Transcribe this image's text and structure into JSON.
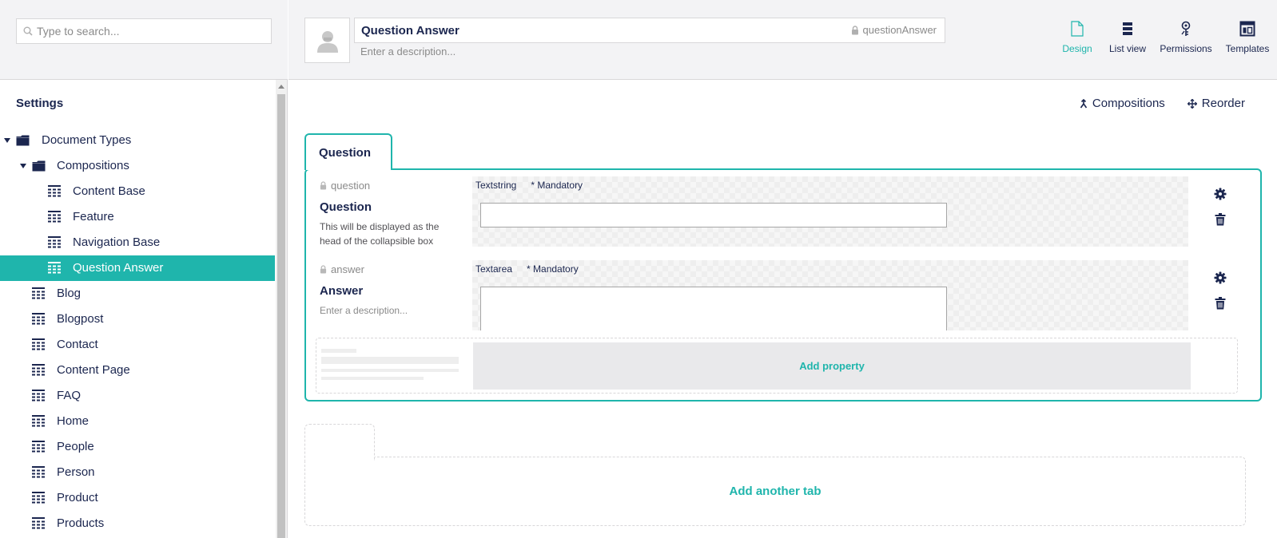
{
  "search": {
    "placeholder": "Type to search..."
  },
  "tree": {
    "title": "Settings",
    "items": [
      {
        "label": "Document Types",
        "level": 0,
        "type": "folder",
        "expanded": true
      },
      {
        "label": "Compositions",
        "level": 1,
        "type": "folder",
        "expanded": true
      },
      {
        "label": "Content Base",
        "level": 2,
        "type": "doctype"
      },
      {
        "label": "Feature",
        "level": 2,
        "type": "doctype"
      },
      {
        "label": "Navigation Base",
        "level": 2,
        "type": "doctype"
      },
      {
        "label": "Question Answer",
        "level": 2,
        "type": "doctype",
        "active": true
      },
      {
        "label": "Blog",
        "level": 1,
        "type": "doctype"
      },
      {
        "label": "Blogpost",
        "level": 1,
        "type": "doctype"
      },
      {
        "label": "Contact",
        "level": 1,
        "type": "doctype"
      },
      {
        "label": "Content Page",
        "level": 1,
        "type": "doctype"
      },
      {
        "label": "FAQ",
        "level": 1,
        "type": "doctype"
      },
      {
        "label": "Home",
        "level": 1,
        "type": "doctype"
      },
      {
        "label": "People",
        "level": 1,
        "type": "doctype"
      },
      {
        "label": "Person",
        "level": 1,
        "type": "doctype"
      },
      {
        "label": "Product",
        "level": 1,
        "type": "doctype"
      },
      {
        "label": "Products",
        "level": 1,
        "type": "doctype"
      }
    ]
  },
  "header": {
    "name": "Question Answer",
    "alias": "questionAnswer",
    "description_placeholder": "Enter a description..."
  },
  "apps": [
    {
      "label": "Design",
      "icon": "document-icon",
      "active": true
    },
    {
      "label": "List view",
      "icon": "list-icon"
    },
    {
      "label": "Permissions",
      "icon": "key-icon"
    },
    {
      "label": "Templates",
      "icon": "layout-icon"
    }
  ],
  "actions": {
    "compositions": "Compositions",
    "reorder": "Reorder"
  },
  "tab": {
    "name": "Question",
    "properties": [
      {
        "alias": "question",
        "name": "Question",
        "description": "This will be displayed as the head of the collapsible box",
        "editor": "Textstring",
        "mandatory": "* Mandatory"
      },
      {
        "alias": "answer",
        "name": "Answer",
        "description": "Enter a description...",
        "editor": "Textarea",
        "mandatory": "* Mandatory"
      }
    ],
    "add_property": "Add property"
  },
  "add_tab": "Add another tab",
  "colors": {
    "accent": "#1fb5ac",
    "text": "#1b264f",
    "muted": "#8a8a8a",
    "panel": "#f3f3f5"
  }
}
